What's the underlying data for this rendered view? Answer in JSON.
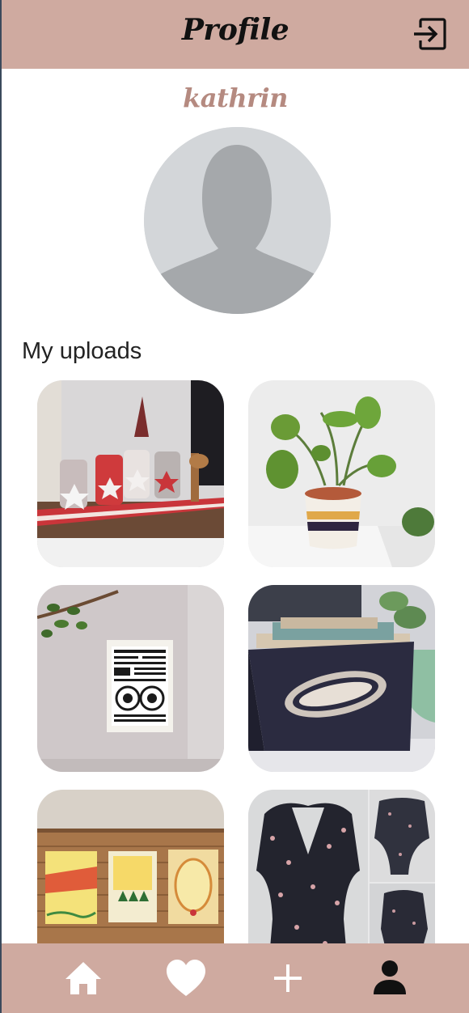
{
  "header": {
    "title": "Profile",
    "logout_icon": "logout-icon"
  },
  "profile": {
    "username": "kathrin",
    "avatar_icon": "default-avatar-icon"
  },
  "uploads": {
    "section_title": "My uploads",
    "items": [
      {
        "subject": "advent candle jars on a table runner"
      },
      {
        "subject": "monstera plant in a striped pot"
      },
      {
        "subject": "graphic art print on a wall"
      },
      {
        "subject": "record box with printed lettering"
      },
      {
        "subject": "three christmas cards on bamboo mat"
      },
      {
        "subject": "floral dress collage"
      }
    ]
  },
  "nav": {
    "items": [
      {
        "icon": "home-icon"
      },
      {
        "icon": "heart-icon"
      },
      {
        "icon": "plus-icon"
      },
      {
        "icon": "person-icon"
      }
    ]
  },
  "colors": {
    "accent": "#cfaaa0",
    "username": "#b58a80",
    "active_nav": "#111111",
    "inactive_nav": "#ffffff"
  }
}
